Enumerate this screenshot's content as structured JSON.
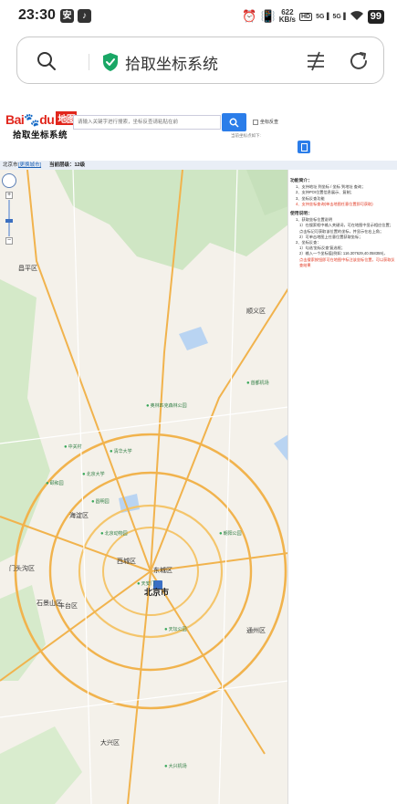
{
  "status_bar": {
    "time": "23:30",
    "notif_icons": [
      "app-icon",
      "tiktok-icon"
    ],
    "net_speed_value": "622",
    "net_speed_unit": "KB/s",
    "hd_badge": "HD",
    "signal_1": "5G",
    "signal_2": "5G",
    "battery": "99",
    "icons": [
      "alarm-icon",
      "vibrate-icon",
      "wifi-icon"
    ]
  },
  "browser": {
    "page_title": "拾取坐标系统",
    "icons": [
      "search-icon",
      "shield-check-icon",
      "filter-icon",
      "reload-icon"
    ],
    "accent": "#1aa766"
  },
  "site": {
    "logo_text": "Bai",
    "logo_du": "du",
    "logo_ditu": "地图",
    "logo_subtitle": "拾取坐标系统",
    "search_placeholder": "请输入关键字进行搜索，坐标反查请粘贴在前",
    "checkbox_label": "坐标反查",
    "search_hint": "当前坐标点如下:",
    "info_city": "北京市",
    "info_change": "[更换城市]",
    "info_zoom": "当前层级：12级",
    "brand_color": "#2b7de9"
  },
  "map": {
    "districts": [
      "昌平区",
      "海淀区",
      "西城区",
      "东城区",
      "丰台区",
      "门头沟区",
      "大兴区",
      "顺义区",
      "通州区",
      "石景山区"
    ],
    "city_label": "北京市",
    "pois": [
      "中关村",
      "天坛公园",
      "北京大学",
      "清华大学",
      "朝阳公园",
      "奥林匹克森林公园",
      "圆明园",
      "颐和园",
      "北京动物园",
      "首都机场",
      "天安门",
      "大兴机场"
    ]
  },
  "panel": {
    "section_1_title": "功能简介：",
    "section_1_items": [
      "1、支持地址 到坐标 / 坐标 到地址 查询；",
      "2、支持POI位置信息展示、复制；",
      "3、坐标反查功能",
      "4、支持坐标查询(单击地图任意位置即可获取)"
    ],
    "section_2_title": "使用说明：",
    "section_2_lines": [
      "1、获取坐标位置说明",
      "1）在搜索框中输入关键词，可在地图中显示相应位置；",
      "点击标记可获取该位置的坐标，并显示在右上角；",
      "2）可单击地图上任意位置获取坐标；",
      "2、坐标反查：",
      "1）勾选'坐标反查'复选框；",
      "2）输入一个坐标值(例如: 116.307629,40.058359)，",
      "点击搜索按钮即可在地图中标注该坐标位置，可以获取反查结果"
    ]
  }
}
